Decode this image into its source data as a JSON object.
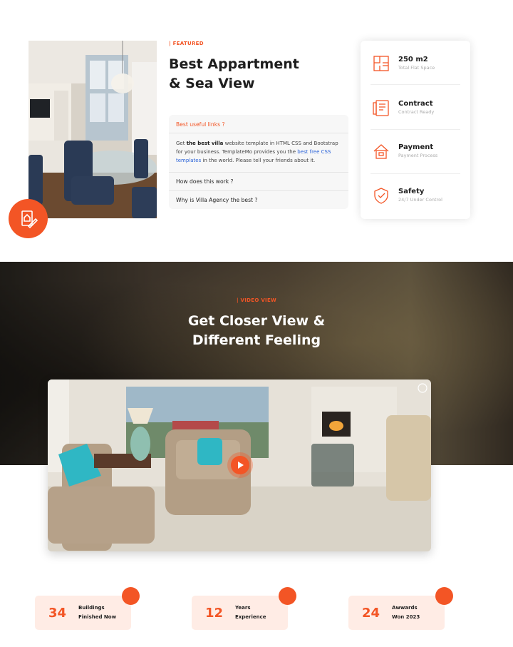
{
  "featured": {
    "tag": "| FEATURED",
    "title_line1": "Best Appartment",
    "title_line2": "& Sea View",
    "accordion": {
      "active_head": "Best useful links ?",
      "body_prefix": "Get ",
      "body_bold": "the best villa",
      "body_mid": " website template in HTML CSS and Bootstrap for your business. TemplateMo provides you the ",
      "body_link": "best free CSS templates",
      "body_suffix": " in the world. Please tell your friends about it.",
      "q2": "How does this work ?",
      "q3": "Why is Villa Agency the best ?"
    },
    "info": [
      {
        "title": "250 m2",
        "subtitle": "Total Flat Space",
        "icon": "floor-plan-icon"
      },
      {
        "title": "Contract",
        "subtitle": "Contract Ready",
        "icon": "contract-icon"
      },
      {
        "title": "Payment",
        "subtitle": "Payment Process",
        "icon": "payment-icon"
      },
      {
        "title": "Safety",
        "subtitle": "24/7 Under Control",
        "icon": "safety-icon"
      }
    ]
  },
  "video": {
    "tag": "| VIDEO VIEW",
    "title_line1": "Get Closer View &",
    "title_line2": "Different Feeling"
  },
  "counters": [
    {
      "number": "34",
      "line1": "Buildings",
      "line2": "Finished Now"
    },
    {
      "number": "12",
      "line1": "Years",
      "line2": "Experience"
    },
    {
      "number": "24",
      "line1": "Awwards",
      "line2": "Won 2023"
    }
  ],
  "colors": {
    "accent": "#f35525",
    "accent_light": "#ffece5",
    "link": "#2a62d8"
  }
}
